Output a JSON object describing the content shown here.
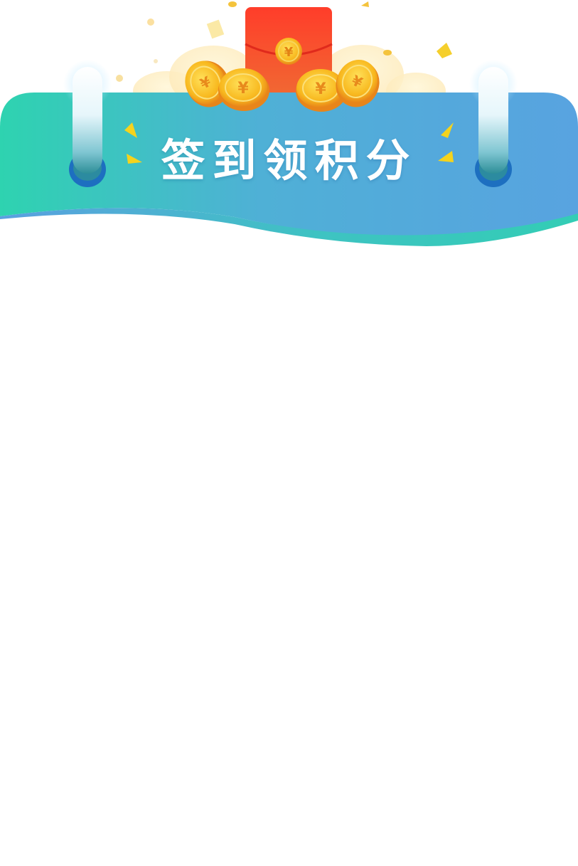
{
  "banner": {
    "title": "签到领积分",
    "coin_symbol": "¥",
    "colors": {
      "gradient_left": "#2ed3b0",
      "gradient_right": "#58a3e0",
      "wave_accent": "#3cc9c0",
      "envelope": "#f5452c",
      "coin": "#f7b91c",
      "spark": "#f5d31d",
      "ring": "#1d6fc0"
    },
    "icons": {
      "envelope": "red-envelope-icon",
      "coins": "gold-coin-icon",
      "sparks": "spark-icon",
      "rings": "binder-ring-icon"
    }
  }
}
